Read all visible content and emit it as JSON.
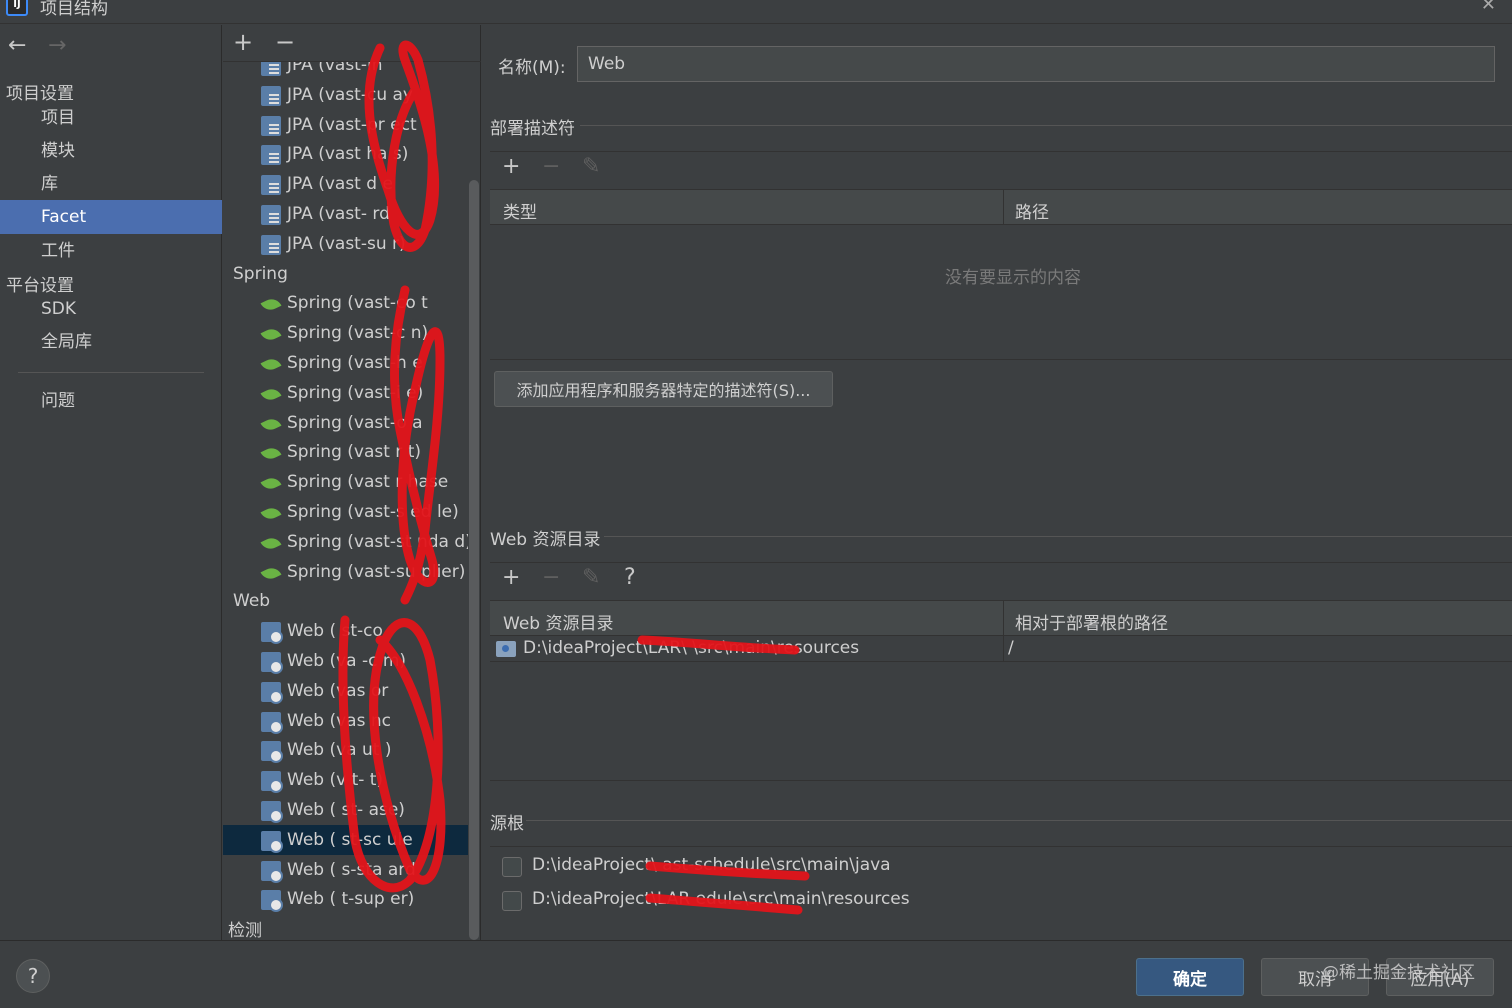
{
  "window": {
    "title": "项目结构"
  },
  "nav": {
    "project_settings": "项目设置",
    "items_project": [
      {
        "label": "项目"
      },
      {
        "label": "模块"
      },
      {
        "label": "库"
      },
      {
        "label": "Facet"
      },
      {
        "label": "工件"
      }
    ],
    "platform_settings": "平台设置",
    "items_platform": [
      {
        "label": "SDK"
      },
      {
        "label": "全局库"
      }
    ],
    "problems": "问题",
    "selected": "Facet"
  },
  "tree": {
    "jpa": [
      "JPA (vast-in",
      "JPA (vast-cu ay",
      "JPA (vast-pr ect",
      "JPA (vast  ha s)",
      "JPA (vast  d e",
      "JPA (vast-  rd",
      "JPA (vast-su   r)"
    ],
    "group_spring": "Spring",
    "spring": [
      "Spring (vast-co t",
      "Spring (vast-c    n)",
      "Spring (vast-h  e",
      "Spring (vast-i   e)",
      "Spring (vast-o  a",
      "Spring (vast  r  t)",
      "Spring (vast  r  hase",
      "Spring (vast-s   ed le)",
      "Spring (vast-st nda d)",
      "Spring (vast-su plier)"
    ],
    "group_web": "Web",
    "web": [
      "Web (  st-co",
      "Web (va  -c    m)",
      "Web (vas  or",
      "Web (vas  nc",
      "Web (va   ut  )",
      "Web (v  t-   t)",
      "Web (  st-  ase)",
      "Web (  st-sc  ule",
      "Web (  s-sta  ard",
      "Web (  t-sup  er)"
    ],
    "selected_index": 7,
    "detect": "检测"
  },
  "detail": {
    "name_label": "名称(M):",
    "name_value": "Web",
    "deploy_descriptors": {
      "title": "部署描述符",
      "col_type": "类型",
      "col_path": "路径",
      "empty": "没有要显示的内容",
      "add_button": "添加应用程序和服务器特定的描述符(S)..."
    },
    "web_resources": {
      "title": "Web 资源目录",
      "col_dir": "Web 资源目录",
      "col_rel": "相对于部署根的路径",
      "rows": [
        {
          "dir": "D:\\ideaProject\\LAR\\              \\src\\main\\resources",
          "rel": "/"
        }
      ],
      "help": "?"
    },
    "source_roots": {
      "title": "源根",
      "items": [
        {
          "path": "D:\\ideaProject\\         ast-schedule\\src\\main\\java",
          "checked": false
        },
        {
          "path": "D:\\ideaProject\\LAR          edule\\src\\main\\resources",
          "checked": false
        }
      ]
    }
  },
  "footer": {
    "ok": "确定",
    "cancel": "取消",
    "apply": "应用(A)",
    "watermark": "@稀土掘金技术社区",
    "help": "?"
  },
  "colors": {
    "selection": "#4b6eaf",
    "tree_selection": "#0d293e",
    "ok_button": "#365880",
    "scribble": "#e3141a"
  }
}
